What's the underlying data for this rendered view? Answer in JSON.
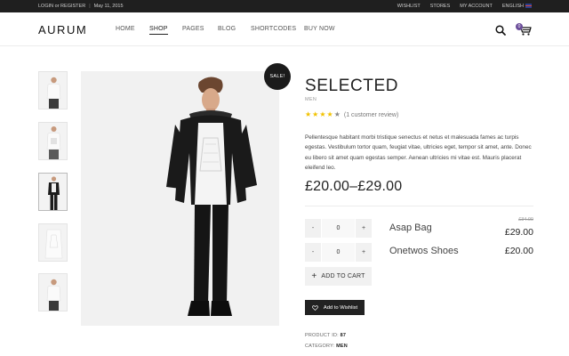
{
  "topbar": {
    "login_register": "LOGIN or REGISTER",
    "date": "May 11, 2015",
    "wishlist": "WISHLIST",
    "stores": "STORES",
    "my_account": "MY ACCOUNT",
    "language": "ENGLISH"
  },
  "header": {
    "logo": "AURUM",
    "nav": [
      "HOME",
      "SHOP",
      "PAGES",
      "BLOG",
      "SHORTCODES",
      "BUY NOW"
    ],
    "active_nav": "SHOP",
    "cart_count": "0"
  },
  "product": {
    "sale_badge": "SALE!",
    "title": "SELECTED",
    "category": "MEN",
    "rating": 4,
    "rating_max": 5,
    "review_text": "(1 customer review)",
    "description": "Pellentesque habitant morbi tristique senectus et netus et malesuada fames ac turpis egestas. Vestibulum tortor quam, feugiat vitae, ultricies eget, tempor sit amet, ante. Donec eu libero sit amet quam egestas semper. Aenean ultricies mi vitae est. Mauris placerat eleifend leo.",
    "price_range": "£20.00–£29.00",
    "grouped": [
      {
        "qty_minus": "-",
        "qty_value": "0",
        "qty_plus": "+",
        "name": "Asap Bag",
        "old_price": "£34.00",
        "price": "£29.00"
      },
      {
        "qty_minus": "-",
        "qty_value": "0",
        "qty_plus": "+",
        "name": "Onetwos Shoes",
        "old_price": "",
        "price": "£20.00"
      }
    ],
    "add_to_cart": "ADD TO CART",
    "add_to_wishlist": "Add to Wishlist",
    "product_id_label": "PRODUCT ID:",
    "product_id": "87",
    "category_label": "CATEGORY:",
    "category_value": "MEN"
  },
  "colors": {
    "topbar_bg": "#1f1f1f",
    "accent_star": "#f2c200",
    "cart_badge": "#6b4d9a",
    "button_dark": "#222222"
  },
  "icons": [
    "search-icon",
    "cart-icon",
    "star-icon",
    "plus-icon",
    "heart-icon",
    "flag-icon"
  ]
}
